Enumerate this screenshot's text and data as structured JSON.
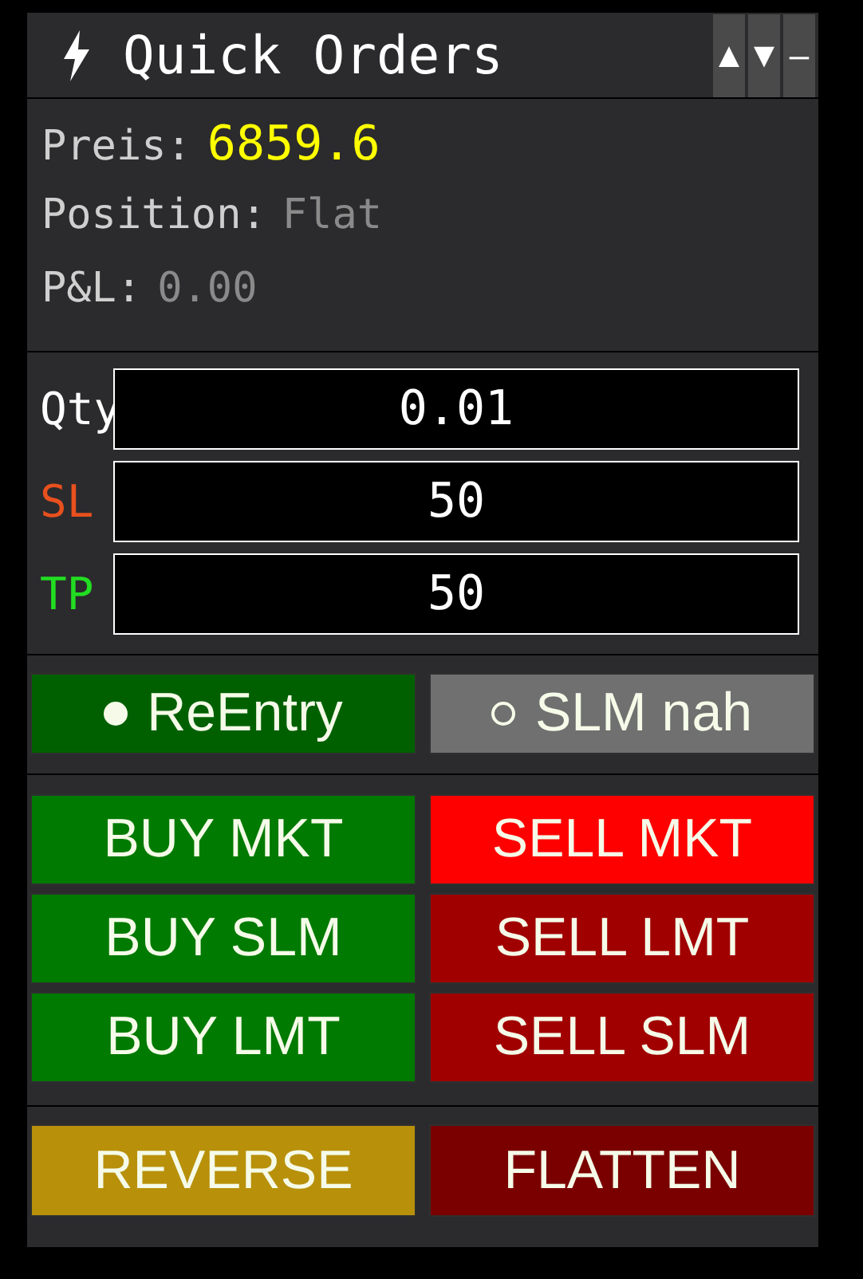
{
  "window": {
    "title": "Quick Orders",
    "controls": [
      "▲",
      "▼",
      "–"
    ]
  },
  "info": [
    {
      "label": "Preis:",
      "value": "6859.6",
      "kind": "price"
    },
    {
      "label": "Position:",
      "value": "Flat",
      "kind": "muted"
    },
    {
      "label": "P&L:",
      "value": "0.00",
      "kind": "muted"
    }
  ],
  "fields": [
    {
      "label": "Qty",
      "value": "0.01",
      "color": "#ffffff"
    },
    {
      "label": "SL",
      "value": "50",
      "color": "#e8501e"
    },
    {
      "label": "TP",
      "value": "50",
      "color": "#22dd22"
    }
  ],
  "toggles": [
    {
      "label": "ReEntry",
      "selected": true
    },
    {
      "label": "SLM nah",
      "selected": false
    }
  ],
  "order_buttons": [
    {
      "label": "BUY MKT",
      "color": "#007a00"
    },
    {
      "label": "SELL MKT",
      "color": "#ff0000"
    },
    {
      "label": "BUY SLM",
      "color": "#007a00"
    },
    {
      "label": "SELL LMT",
      "color": "#a00000"
    },
    {
      "label": "BUY LMT",
      "color": "#007a00"
    },
    {
      "label": "SELL SLM",
      "color": "#a00000"
    }
  ],
  "action_buttons": [
    {
      "label": "REVERSE",
      "color": "#b8900a"
    },
    {
      "label": "FLATTEN",
      "color": "#7a0000"
    }
  ]
}
